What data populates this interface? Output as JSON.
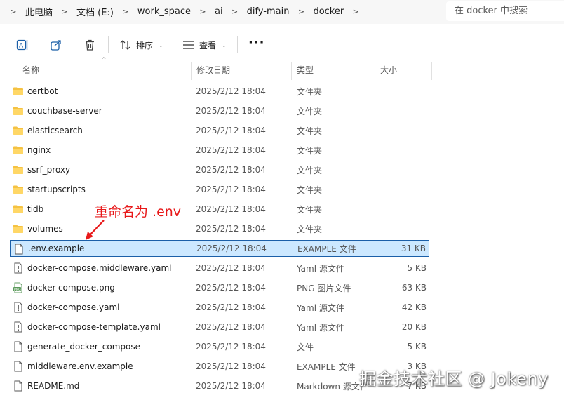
{
  "breadcrumb": [
    "此电脑",
    "文档 (E:)",
    "work_space",
    "ai",
    "dify-main",
    "docker"
  ],
  "search": {
    "placeholder": "在 docker 中搜索"
  },
  "toolbar": {
    "sort_label": "排序",
    "view_label": "查看",
    "more_label": "···"
  },
  "columns": {
    "name": "名称",
    "date": "修改日期",
    "type": "类型",
    "size": "大小"
  },
  "files": [
    {
      "icon": "folder-icon",
      "name": "certbot",
      "date": "2025/2/12 18:04",
      "type": "文件夹",
      "size": ""
    },
    {
      "icon": "folder-icon",
      "name": "couchbase-server",
      "date": "2025/2/12 18:04",
      "type": "文件夹",
      "size": ""
    },
    {
      "icon": "folder-icon",
      "name": "elasticsearch",
      "date": "2025/2/12 18:04",
      "type": "文件夹",
      "size": ""
    },
    {
      "icon": "folder-icon",
      "name": "nginx",
      "date": "2025/2/12 18:04",
      "type": "文件夹",
      "size": ""
    },
    {
      "icon": "folder-icon",
      "name": "ssrf_proxy",
      "date": "2025/2/12 18:04",
      "type": "文件夹",
      "size": ""
    },
    {
      "icon": "folder-icon",
      "name": "startupscripts",
      "date": "2025/2/12 18:04",
      "type": "文件夹",
      "size": ""
    },
    {
      "icon": "folder-icon",
      "name": "tidb",
      "date": "2025/2/12 18:04",
      "type": "文件夹",
      "size": ""
    },
    {
      "icon": "folder-icon",
      "name": "volumes",
      "date": "2025/2/12 18:04",
      "type": "文件夹",
      "size": ""
    },
    {
      "icon": "file-icon",
      "name": ".env.example",
      "date": "2025/2/12 18:04",
      "type": "EXAMPLE 文件",
      "size": "31 KB",
      "selected": true
    },
    {
      "icon": "config-file-icon",
      "name": "docker-compose.middleware.yaml",
      "date": "2025/2/12 18:04",
      "type": "Yaml 源文件",
      "size": "5 KB"
    },
    {
      "icon": "image-file-icon",
      "name": "docker-compose.png",
      "date": "2025/2/12 18:04",
      "type": "PNG 图片文件",
      "size": "63 KB"
    },
    {
      "icon": "config-file-icon",
      "name": "docker-compose.yaml",
      "date": "2025/2/12 18:04",
      "type": "Yaml 源文件",
      "size": "42 KB"
    },
    {
      "icon": "config-file-icon",
      "name": "docker-compose-template.yaml",
      "date": "2025/2/12 18:04",
      "type": "Yaml 源文件",
      "size": "20 KB"
    },
    {
      "icon": "file-icon",
      "name": "generate_docker_compose",
      "date": "2025/2/12 18:04",
      "type": "文件",
      "size": "5 KB"
    },
    {
      "icon": "file-icon",
      "name": "middleware.env.example",
      "date": "2025/2/12 18:04",
      "type": "EXAMPLE 文件",
      "size": "3 KB"
    },
    {
      "icon": "file-icon",
      "name": "README.md",
      "date": "2025/2/12 18:04",
      "type": "Markdown 源文件",
      "size": "7 KB"
    }
  ],
  "annotation": {
    "text": "重命名为 .env",
    "color": "#e8191a"
  },
  "watermark": "掘金技术社区 @ Jokeny",
  "colors": {
    "selection_bg": "#cce8ff",
    "selection_border": "#1b5fa8",
    "folder": "#f5c242",
    "accent": "#1b5fa8"
  }
}
